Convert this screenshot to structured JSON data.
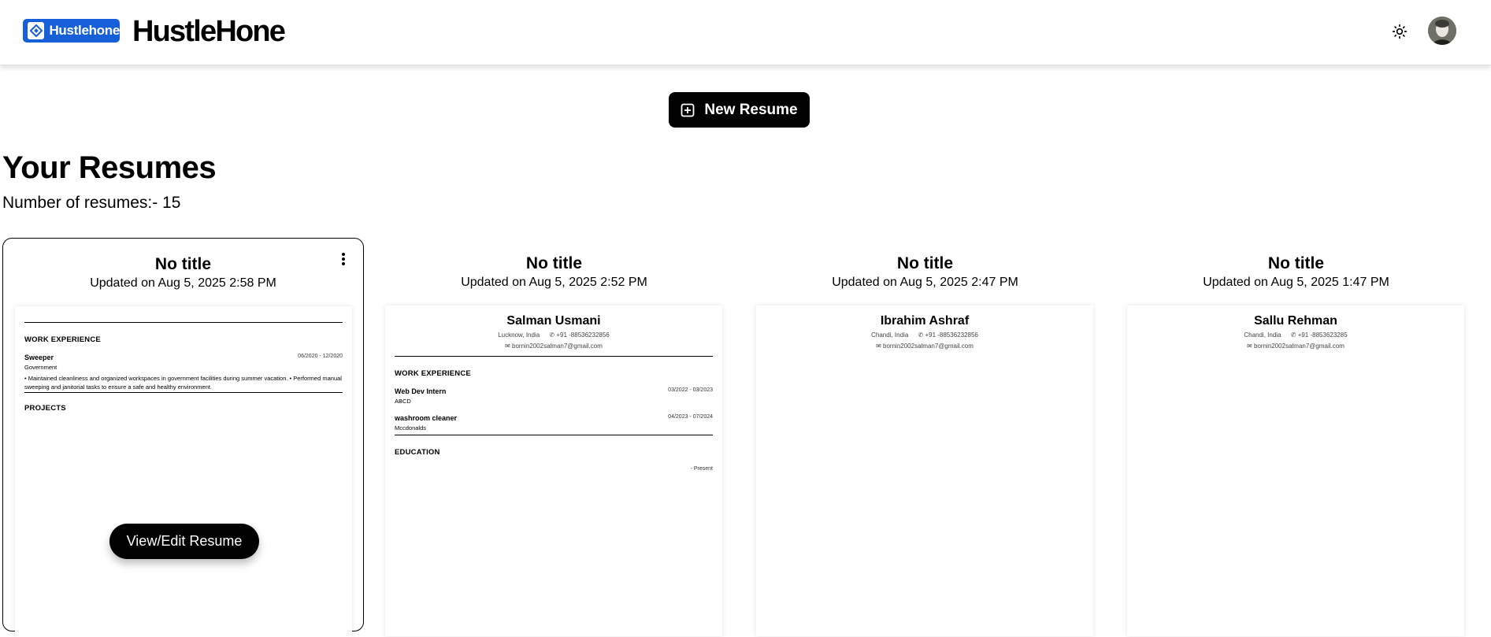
{
  "header": {
    "logo_badge_text": "Hustlehone",
    "brand_name": "HustleHone",
    "accent_color": "#1560d9"
  },
  "actions": {
    "new_resume_label": "New Resume"
  },
  "main": {
    "title": "Your Resumes",
    "count_text": "Number of resumes:- 15"
  },
  "resumes": [
    {
      "title": "No title",
      "updated": "Updated on Aug 5, 2025 2:58 PM",
      "view_edit_label": "View/Edit Resume",
      "preview": {
        "work_heading": "WORK EXPERIENCE",
        "job_title": "Sweeper",
        "job_dates": "06/2020 - 12/2020",
        "company": "Government",
        "bullets": "• Maintained cleanliness and organized workspaces in government facilities during summer vacation. • Performed manual sweeping and janitorial tasks to ensure a safe and healthy environment.",
        "projects_heading": "PROJECTS"
      }
    },
    {
      "title": "No title",
      "updated": "Updated on Aug 5, 2025 2:52 PM",
      "preview": {
        "name": "Salman Usmani",
        "location": "Lucknow, India",
        "phone": "+91 -88536232856",
        "email": "bornin2002salman7@gmail.com",
        "work_heading": "WORK EXPERIENCE",
        "job1_title": "Web Dev Intern",
        "job1_dates": "03/2022 - 03/2023",
        "job1_company": "ABCD",
        "job2_title": "washroom cleaner",
        "job2_dates": "04/2023 - 07/2024",
        "job2_company": "Mccdonalds",
        "education_heading": "EDUCATION",
        "education_dates": "- Present"
      }
    },
    {
      "title": "No title",
      "updated": "Updated on Aug 5, 2025 2:47 PM",
      "preview": {
        "name": "Ibrahim Ashraf",
        "location": "Chandi, India",
        "phone": "+91 -88536232856",
        "email": "bornin2002salman7@gmail.com"
      }
    },
    {
      "title": "No title",
      "updated": "Updated on Aug 5, 2025 1:47 PM",
      "preview": {
        "name": "Sallu Rehman",
        "location": "Chandi, India",
        "phone": "+91 -8853623285",
        "email": "bornin2002salman7@gmail.com"
      }
    }
  ],
  "icons": {
    "logo": "diamond-logo-icon",
    "theme_toggle": "sun-icon",
    "avatar": "user-avatar",
    "new_resume": "plus-square-icon",
    "menu": "kebab-menu-icon",
    "phone": "phone-icon",
    "email": "mail-icon"
  }
}
